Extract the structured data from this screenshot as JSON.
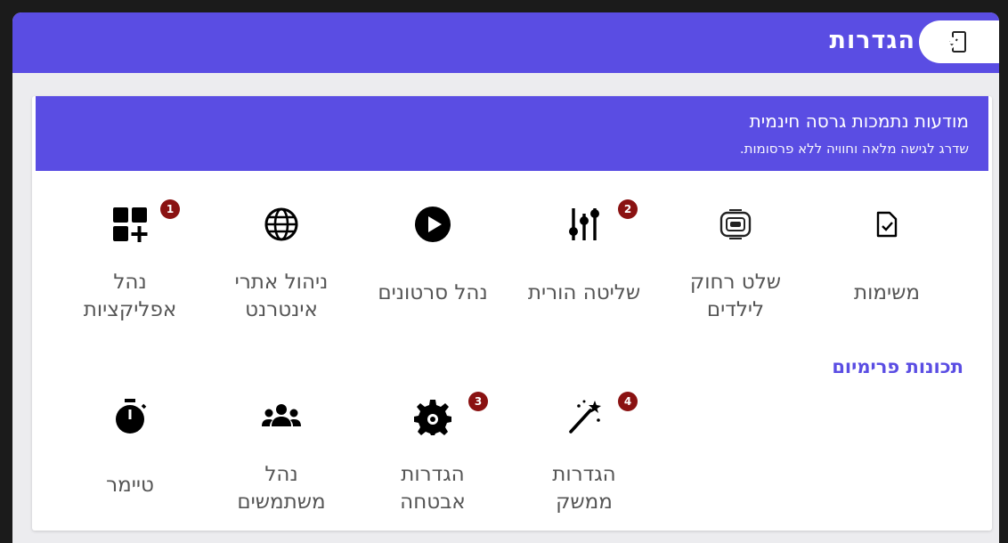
{
  "header": {
    "title": "הגדרות"
  },
  "banner": {
    "title": "מודעות נתמכות גרסה חינמית",
    "subtitle": "שדרג לגישה מלאה וחוויה ללא פרסומות."
  },
  "features": [
    {
      "line1": "משימות",
      "line2": "",
      "icon": "task-checklist-icon",
      "badge": ""
    },
    {
      "line1": "שלט רחוק",
      "line2": "לילדים",
      "icon": "remote-control-icon",
      "badge": ""
    },
    {
      "line1": "שליטה הורית",
      "line2": "",
      "icon": "sliders-icon",
      "badge": "2"
    },
    {
      "line1": "נהל סרטונים",
      "line2": "",
      "icon": "play-icon",
      "badge": ""
    },
    {
      "line1": "ניהול אתרי",
      "line2": "אינטרנט",
      "icon": "globe-icon",
      "badge": ""
    },
    {
      "line1": "נהל",
      "line2": "אפליקציות",
      "icon": "apps-add-icon",
      "badge": "1"
    }
  ],
  "premium": {
    "title": "תכונות פרימיום",
    "items": [
      {
        "line1": "הגדרות",
        "line2": "ממשק",
        "icon": "magic-wand-icon",
        "badge": "4"
      },
      {
        "line1": "הגדרות",
        "line2": "אבטחה",
        "icon": "security-gear-icon",
        "badge": "3"
      },
      {
        "line1": "נהל",
        "line2": "משתמשים",
        "icon": "users-icon",
        "badge": ""
      },
      {
        "line1": "טיימר",
        "line2": "",
        "icon": "timer-icon",
        "badge": ""
      }
    ]
  }
}
